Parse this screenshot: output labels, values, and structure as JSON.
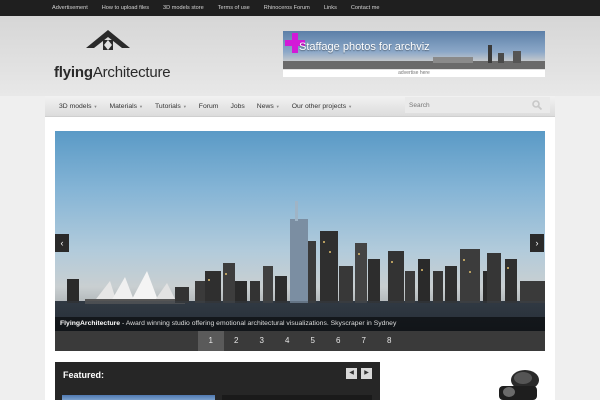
{
  "topbar": {
    "links": [
      "Advertisement",
      "How to upload files",
      "3D models store",
      "Terms of use",
      "Rhinoceros Forum",
      "Links",
      "Contact me"
    ]
  },
  "logo": {
    "bold": "flying",
    "rest": "Architecture"
  },
  "banner": {
    "text": "Staffage photos for archviz",
    "advertise": "advertise here"
  },
  "nav": {
    "items": [
      {
        "label": "3D models",
        "dropdown": true
      },
      {
        "label": "Materials",
        "dropdown": true
      },
      {
        "label": "Tutorials",
        "dropdown": true
      },
      {
        "label": "Forum",
        "dropdown": false
      },
      {
        "label": "Jobs",
        "dropdown": false
      },
      {
        "label": "News",
        "dropdown": true
      },
      {
        "label": "Our other projects",
        "dropdown": true
      }
    ],
    "search_placeholder": "Search"
  },
  "slider": {
    "prev": "‹",
    "next": "›",
    "caption_title": "FlyingArchitecture",
    "caption_text": " - Award winning studio offering emotional architectural visualizations. Skyscraper in Sydney",
    "pages": [
      "1",
      "2",
      "3",
      "4",
      "5",
      "6",
      "7",
      "8"
    ],
    "active_page": 0
  },
  "featured": {
    "title": "Featured:",
    "prev": "◀",
    "next": "▶"
  },
  "icons": {
    "search": "search-icon",
    "logo": "house-roof-icon"
  },
  "colors": {
    "topbar": "#1f1f1f",
    "accent": "#d21ad7",
    "pager": "#3a3a3a"
  }
}
